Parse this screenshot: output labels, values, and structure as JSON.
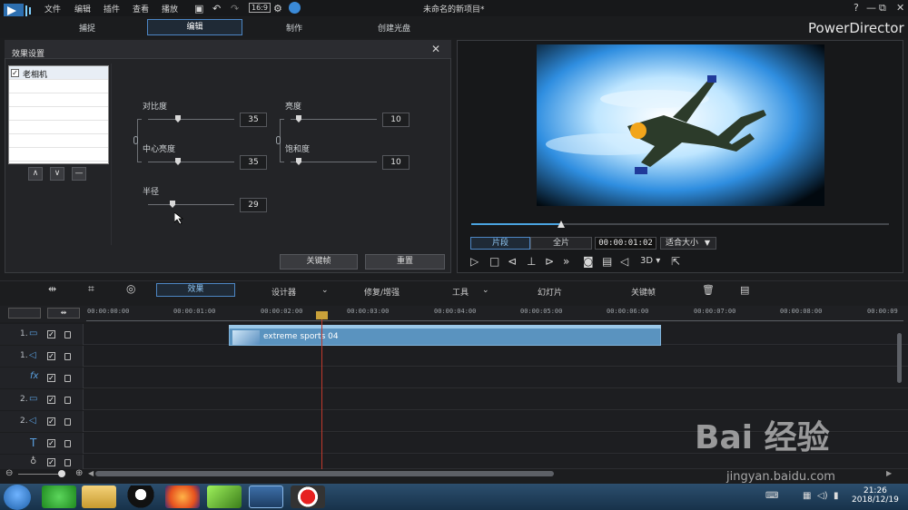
{
  "menu": [
    "文件",
    "编辑",
    "插件",
    "查看",
    "播放"
  ],
  "window_title": "未命名的新项目*",
  "window_controls": [
    "?",
    "—",
    "⧉",
    "⊞",
    "✕"
  ],
  "modes": [
    "捕捉",
    "编辑",
    "制作",
    "创建光盘"
  ],
  "brand": "PowerDirector",
  "effect_panel": {
    "title": "效果设置",
    "close": "✕",
    "effect_item": "老相机",
    "list_buttons": [
      "∧",
      "∨",
      "—"
    ],
    "params": {
      "contrast": {
        "label": "对比度",
        "value": "35"
      },
      "center_brightness": {
        "label": "中心亮度",
        "value": "35"
      },
      "radius": {
        "label": "半径",
        "value": "29"
      },
      "brightness": {
        "label": "亮度",
        "value": "10"
      },
      "saturation": {
        "label": "饱和度",
        "value": "10"
      }
    },
    "keyframe_button": "关键帧",
    "reset_button": "重置"
  },
  "preview": {
    "clip_tab": "片段",
    "movie_tab": "全片",
    "timecode": "00:00:01:02",
    "fit_size": "适合大小",
    "fit_caret": "▼",
    "mode_3d": "3D ▾",
    "scrub_progress": 0.21
  },
  "toolbar": {
    "effect": "效果",
    "designer": "设计器",
    "fix_enhance": "修复/增强",
    "tools": "工具",
    "slideshow": "幻灯片",
    "keyframe": "关键帧"
  },
  "ruler": [
    "00:00:00:00",
    "00:00:01:00",
    "00:00:02:00",
    "00:00:03:00",
    "00:00:04:00",
    "00:00:05:00",
    "00:00:06:00",
    "00:00:07:00",
    "00:00:08:00",
    "00:00:09"
  ],
  "tracks": [
    "1.",
    "1.",
    "",
    "2.",
    "2.",
    "",
    ""
  ],
  "clip_label": "extreme sports 04",
  "watermark": {
    "main": "Bai 经验",
    "sub": "jingyan.baidu.com"
  },
  "clock": {
    "time": "21:26",
    "date": "2018/12/19"
  },
  "colors": {
    "accent": "#4d86c4",
    "clip": "#5a93bf",
    "playhead": "#c0392b"
  }
}
